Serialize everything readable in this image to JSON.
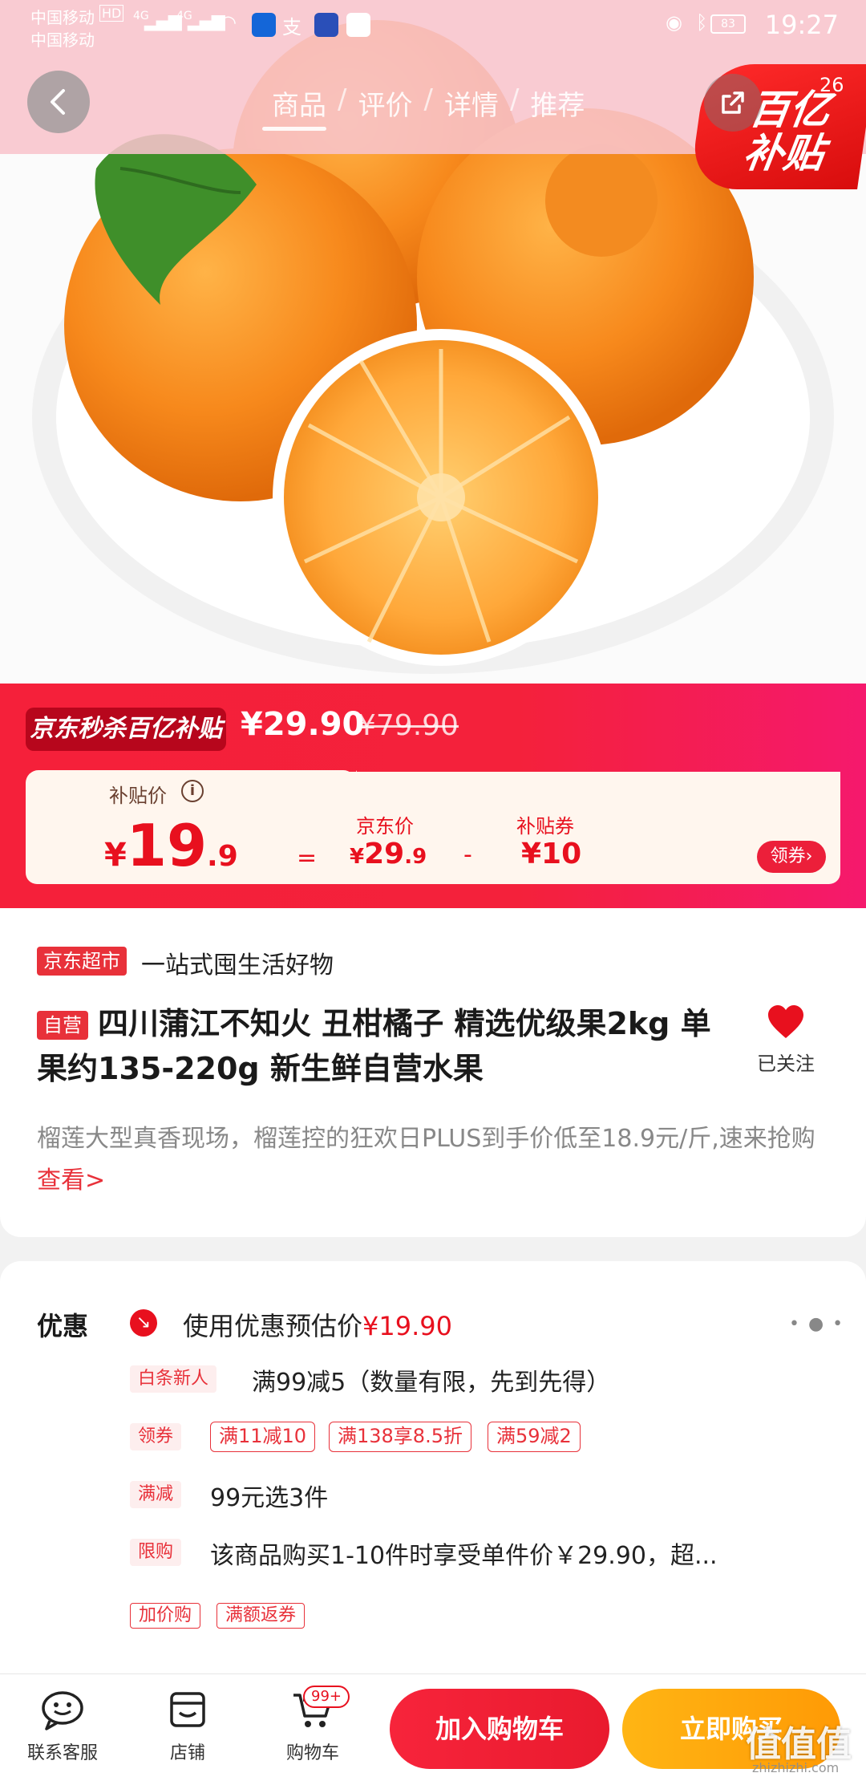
{
  "status_bar": {
    "carrier_primary": "中国移动",
    "carrier_hd": "HD",
    "carrier_secondary": "中国移动",
    "network1": "4G",
    "network2": "4G",
    "battery": "83",
    "time": "19:27"
  },
  "nav": {
    "tabs": [
      "商品",
      "评价",
      "详情",
      "推荐"
    ],
    "active_tab": "商品",
    "badge_text": "百亿补贴",
    "badge_count": "26"
  },
  "price_banner": {
    "promo_tag": "京东秒杀百亿补贴",
    "sale_price": "¥29.90",
    "original_price": "¥79.90",
    "subsidy_label": "补贴价",
    "subsidy_currency": "¥",
    "subsidy_integer": "19",
    "subsidy_decimal": ".9",
    "equals": "=",
    "jd_price_label": "京东价",
    "jd_price_currency": "¥",
    "jd_price_integer": "29",
    "jd_price_decimal": ".9",
    "minus": "-",
    "coupon_label": "补贴券",
    "coupon_value": "¥10",
    "claim_button": "领券›"
  },
  "product": {
    "store_tag": "京东超市",
    "store_slogan": "一站式囤生活好物",
    "self_operated_tag": "自营",
    "title": "四川蒲江不知火 丑柑橘子 精选优级果2kg 单果约135-220g 新生鲜自营水果",
    "follow_label": "已关注",
    "promo_text": "榴莲大型真香现场，榴莲控的狂欢日PLUS到手价低至18.9元/斤,速来抢购",
    "promo_link": "查看>"
  },
  "discounts": {
    "section_title": "优惠",
    "estimate_prefix": "使用优惠预估价",
    "estimate_price": "¥19.90",
    "more": "• ● •",
    "rows": [
      {
        "tag": "白条新人",
        "text": "满99减5（数量有限，先到先得）"
      },
      {
        "tag": "领券",
        "chips": [
          "满11减10",
          "满138享8.5折",
          "满59减2"
        ]
      },
      {
        "tag": "满减",
        "text": "99元选3件"
      },
      {
        "tag": "限购",
        "text": "该商品购买1-10件时享受单件价￥29.90，超..."
      }
    ],
    "extra_tags": [
      "加价购",
      "满额返券"
    ]
  },
  "bottom_bar": {
    "service_label": "联系客服",
    "store_label": "店铺",
    "cart_label": "购物车",
    "cart_badge": "99+",
    "add_to_cart": "加入购物车",
    "buy_now": "立即购买"
  },
  "watermark": {
    "logo": "值值值",
    "site": "zhizhizhi.com"
  },
  "colors": {
    "brand_red": "#e8101e",
    "buy_orange": "#ffa60a",
    "banner_gradient_end": "#f5196d"
  }
}
